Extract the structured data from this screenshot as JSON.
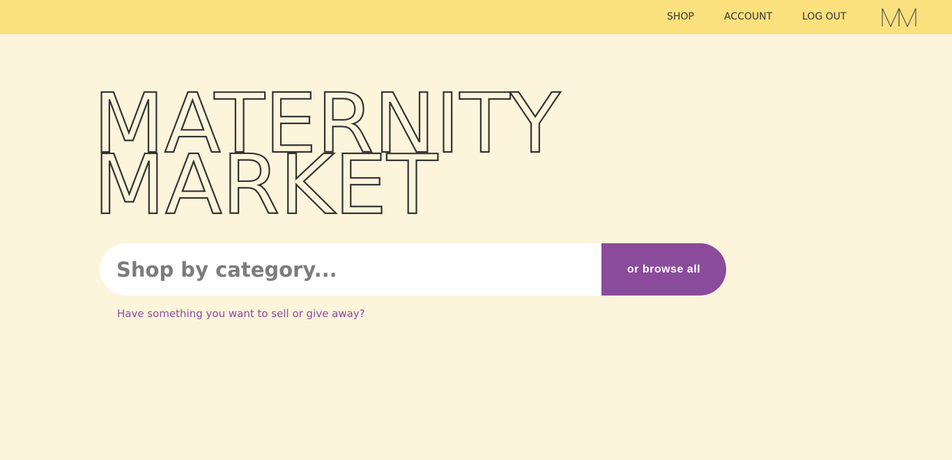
{
  "nav": {
    "shop": "SHOP",
    "account": "ACCOUNT",
    "logout": "LOG OUT",
    "logo_text": "MM"
  },
  "hero": {
    "line1": "MATERNITY",
    "line2": "MARKET"
  },
  "search": {
    "placeholder": "Shop by category...",
    "value": "",
    "browse_label": "or browse all"
  },
  "sell_link": "Have something you want to sell or give away?",
  "colors": {
    "topbar": "#fbe17d",
    "background": "#fdf4dc",
    "accent": "#8a4b9b",
    "text": "#333333"
  }
}
